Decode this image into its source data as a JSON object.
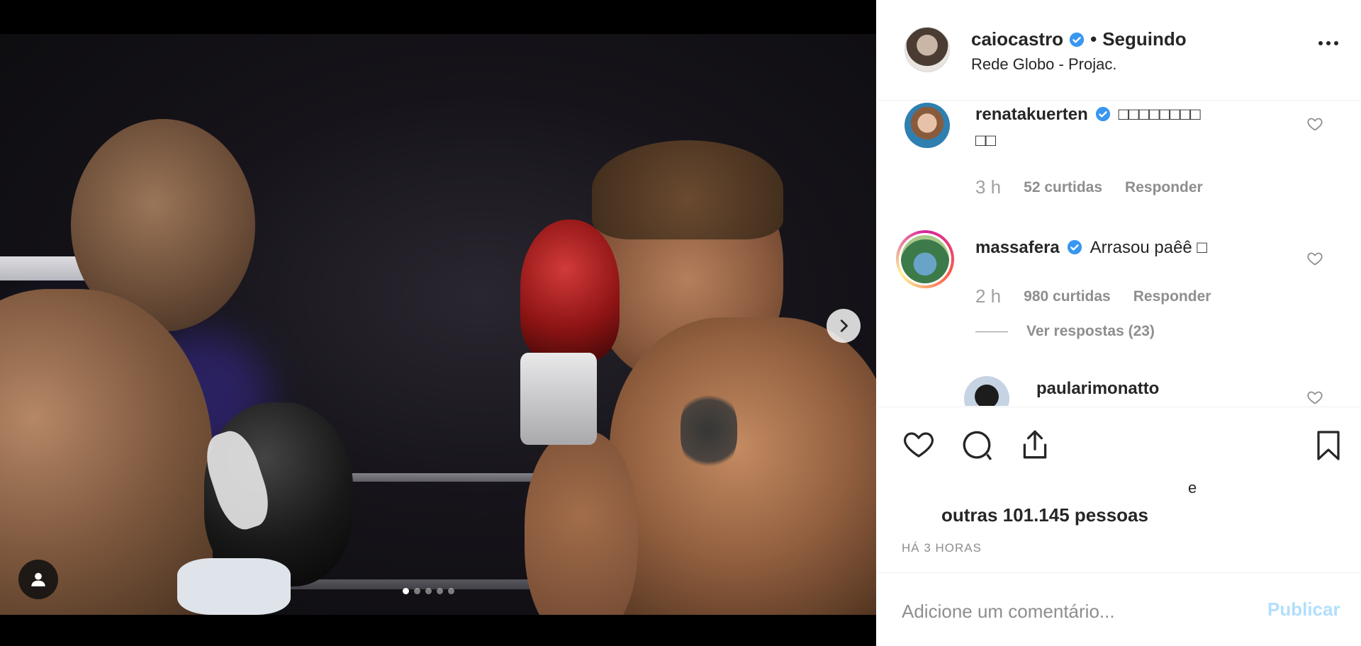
{
  "post": {
    "username": "caiocastro",
    "separator": "•",
    "follow_status": "Seguindo",
    "location": "Rede Globo - Projac.",
    "likes_prefix": "e",
    "likes_text": "outras 101.145 pessoas",
    "time_ago": "HÁ 3 HORAS"
  },
  "media": {
    "slide_count": 5,
    "active_slide": 1,
    "icons": {
      "next": "chevron-right-icon",
      "tag": "user-tag-icon"
    }
  },
  "comments": [
    {
      "username": "renatakuerten",
      "verified": true,
      "text": "□□□□□□□□",
      "text_cont": "□□",
      "time": "3 h",
      "likes": "52 curtidas",
      "reply": "Responder"
    },
    {
      "username": "massafera",
      "verified": true,
      "text": "Arrasou paêê □",
      "time": "2 h",
      "likes": "980 curtidas",
      "reply": "Responder",
      "view_replies": "Ver respostas (23)"
    },
    {
      "username": "paularimonatto",
      "verified": false,
      "text": ""
    }
  ],
  "actions": {
    "icons": [
      "heart-icon",
      "comment-icon",
      "share-icon",
      "bookmark-icon"
    ]
  },
  "add_comment": {
    "placeholder": "Adicione um comentário...",
    "publish": "Publicar"
  },
  "colors": {
    "verified": "#3897f0",
    "publish_disabled": "#b2dffc",
    "muted": "#8e8e8e",
    "text": "#262626"
  }
}
